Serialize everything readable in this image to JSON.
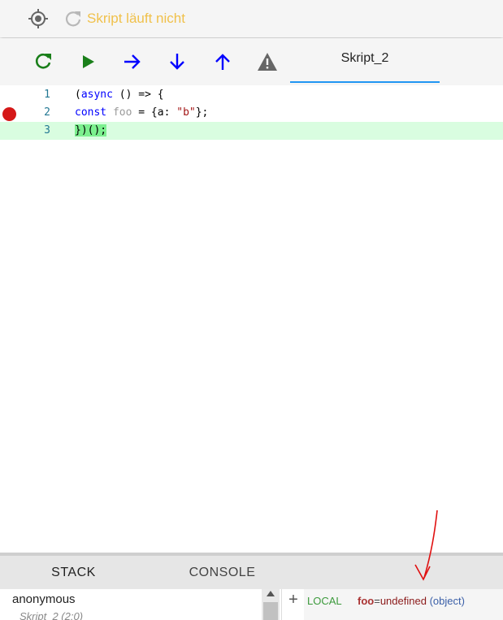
{
  "status": {
    "text": "Skript läuft nicht",
    "color": "#f0c14b"
  },
  "toolbar": {
    "buttons": [
      {
        "name": "restart",
        "icon": "restart-icon",
        "color": "#1a7f1a"
      },
      {
        "name": "resume",
        "icon": "play-icon",
        "color": "#1a7f1a"
      },
      {
        "name": "step-over",
        "icon": "arrow-right-icon",
        "color": "#0000ff"
      },
      {
        "name": "step-into",
        "icon": "arrow-down-icon",
        "color": "#0000ff"
      },
      {
        "name": "step-out",
        "icon": "arrow-up-icon",
        "color": "#0000ff"
      },
      {
        "name": "warning",
        "icon": "warning-icon",
        "color": "#666666"
      }
    ],
    "tab_label": "Skript_2"
  },
  "editor": {
    "lines": [
      {
        "number": "1",
        "breakpoint": false,
        "current": false
      },
      {
        "number": "2",
        "breakpoint": true,
        "current": false
      },
      {
        "number": "3",
        "breakpoint": false,
        "current": true
      }
    ],
    "tokens": {
      "l1_open": "(",
      "l1_async": "async",
      "l1_rest": " () => {",
      "l2_const": "const",
      "l2_sp1": " ",
      "l2_var": "foo",
      "l2_mid": " = {a: ",
      "l2_str": "\"b\"",
      "l2_end": "};",
      "l3_code": "})();"
    }
  },
  "bottom_tabs": {
    "stack": "STACK",
    "console": "CONSOLE"
  },
  "stack": {
    "function": "anonymous",
    "location": "Skript_2 (2:0)"
  },
  "scope": {
    "add_label": "+",
    "scope_name": "LOCAL",
    "var_name": "foo",
    "equals": "=",
    "value": "undefined",
    "type": "(object)"
  }
}
